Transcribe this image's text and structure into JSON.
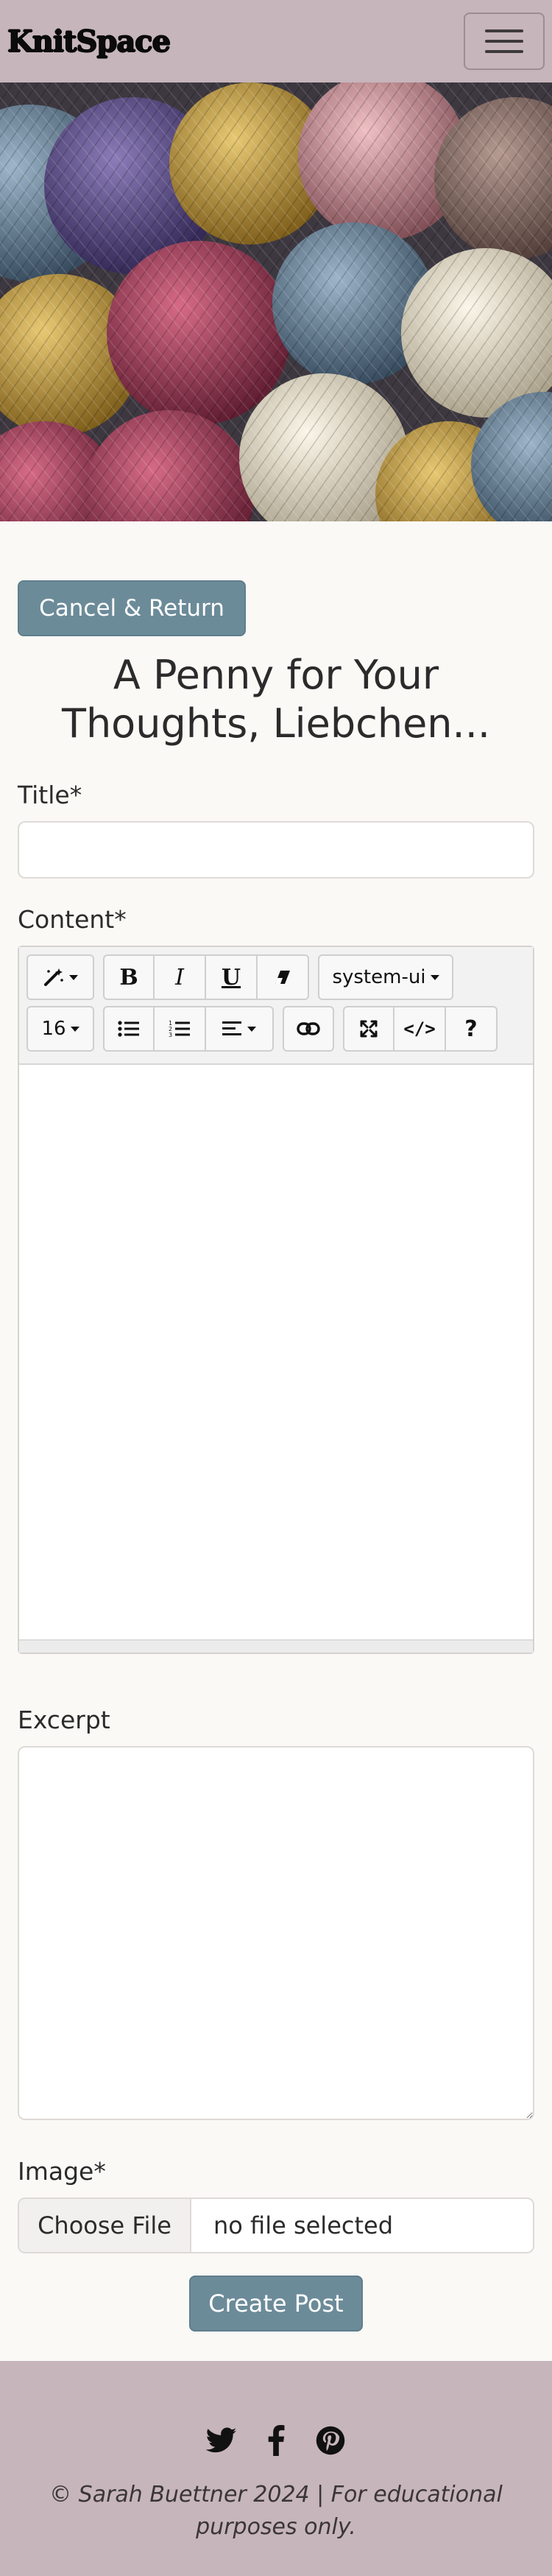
{
  "navbar": {
    "brand": "KnitSpace",
    "menu_icon": "hamburger-menu-icon"
  },
  "hero": {
    "description_icon": "yarn-balls-photo"
  },
  "form": {
    "cancel_label": "Cancel & Return",
    "heading": "A Penny for Your Thoughts, Liebchen...",
    "title_label": "Title*",
    "title_value": "",
    "content_label": "Content*",
    "excerpt_label": "Excerpt",
    "excerpt_value": "",
    "image_label": "Image*",
    "choose_file_label": "Choose File",
    "file_status": "no file selected",
    "submit_label": "Create Post"
  },
  "editor": {
    "toolbar": {
      "style_icon": "magic-wand-icon",
      "bold": "B",
      "italic": "I",
      "underline": "U",
      "clear_icon": "eraser-icon",
      "font_name": "system-ui",
      "font_size": "16",
      "ul_icon": "unordered-list-icon",
      "ol_icon": "ordered-list-icon",
      "align_icon": "align-left-icon",
      "link_icon": "link-icon",
      "fullscreen_icon": "fullscreen-icon",
      "codeview": "</>",
      "help": "?"
    },
    "content": ""
  },
  "footer": {
    "social_icons": [
      "twitter-icon",
      "facebook-icon",
      "pinterest-icon"
    ],
    "copyright": "© Sarah Buettner 2024 | For educational purposes only."
  },
  "colors": {
    "navbar_bg": "#c6b5bb",
    "button_bg": "#6c8b99",
    "page_bg": "#faf9f6"
  }
}
